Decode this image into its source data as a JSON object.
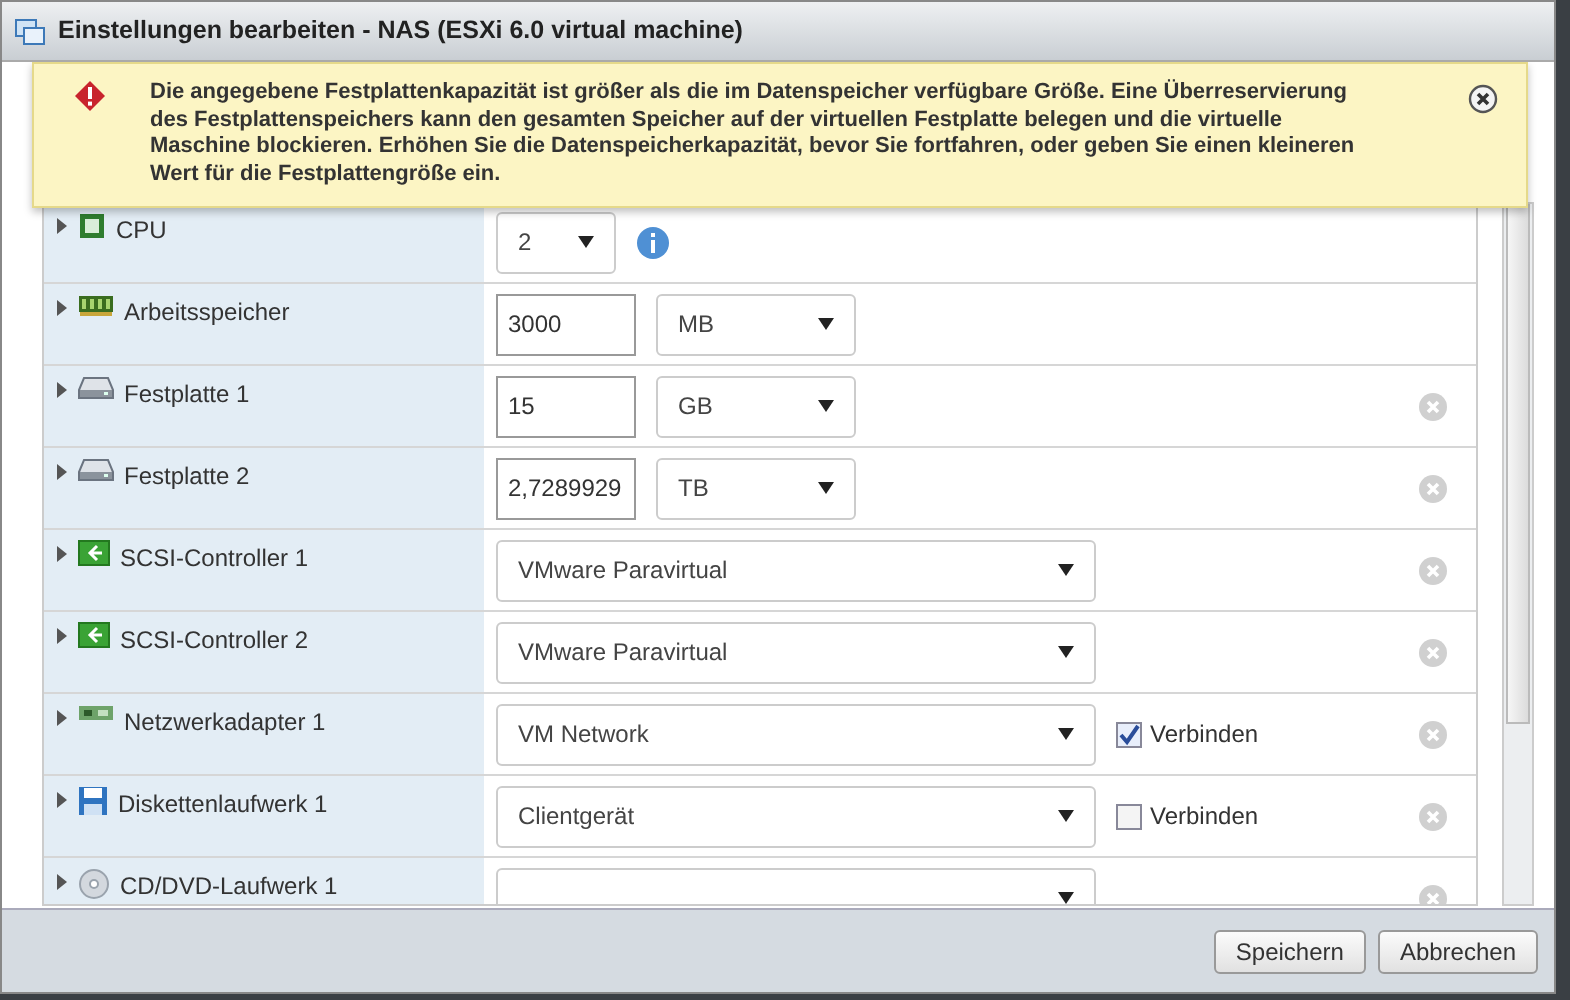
{
  "window": {
    "title": "Einstellungen bearbeiten - NAS (ESXi 6.0 virtual machine)"
  },
  "warning": {
    "message": "Die angegebene Festplattenkapazität ist größer als die im Datenspeicher verfügbare Größe. Eine Überreservierung des Festplattenspeichers kann den gesamten Speicher auf der virtuellen Festplatte belegen und die virtuelle Maschine blockieren. Erhöhen Sie die Datenspeicherkapazität, bevor Sie fortfahren, oder geben Sie einen kleineren Wert für die Festplattengröße ein."
  },
  "devices": [
    {
      "label": "CPU",
      "kind": "cpu",
      "expanded": false,
      "removable": false,
      "value": "2"
    },
    {
      "label": "Arbeitsspeicher",
      "kind": "memory",
      "expanded": false,
      "removable": false,
      "value": "3000",
      "unit": "MB"
    },
    {
      "label": "Festplatte 1",
      "kind": "disk",
      "expanded": false,
      "removable": true,
      "value": "15",
      "unit": "GB"
    },
    {
      "label": "Festplatte 2",
      "kind": "disk",
      "expanded": false,
      "removable": true,
      "value": "2,7289929",
      "unit": "TB"
    },
    {
      "label": "SCSI-Controller 1",
      "kind": "controller",
      "expanded": false,
      "removable": true,
      "value": "VMware Paravirtual"
    },
    {
      "label": "SCSI-Controller 2",
      "kind": "controller",
      "expanded": false,
      "removable": true,
      "value": "VMware Paravirtual"
    },
    {
      "label": "Netzwerkadapter 1",
      "kind": "network",
      "expanded": false,
      "removable": true,
      "value": "VM Network",
      "connected": true,
      "connect_label": "Verbinden"
    },
    {
      "label": "Diskettenlaufwerk 1",
      "kind": "floppy",
      "expanded": false,
      "removable": true,
      "value": "Clientgerät",
      "connected": false,
      "connect_label": "Verbinden"
    },
    {
      "label": "CD/DVD-Laufwerk 1",
      "kind": "cdrom",
      "expanded": false,
      "removable": true
    }
  ],
  "buttons": [
    "Speichern",
    "Abbrechen"
  ]
}
